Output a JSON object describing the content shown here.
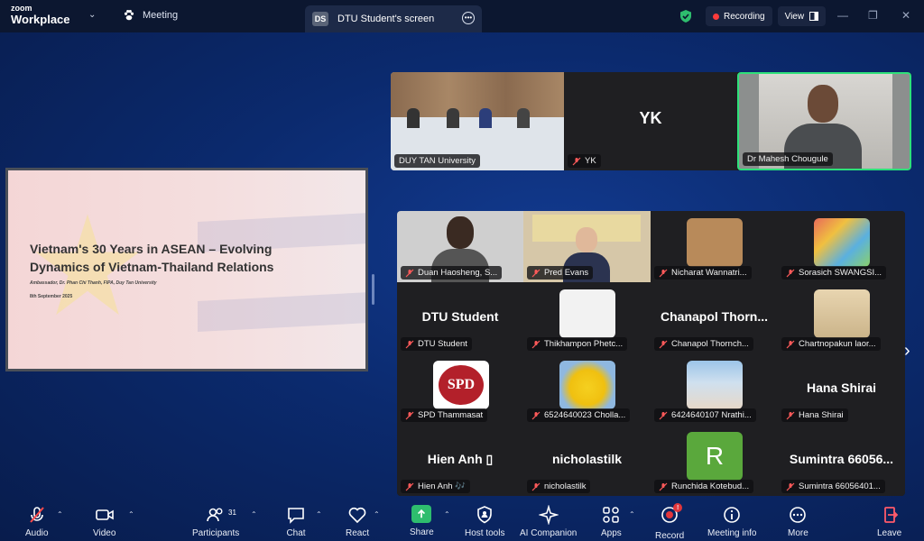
{
  "app": {
    "logo_top": "zoom",
    "logo_bottom": "Workplace"
  },
  "tabs": {
    "meeting_label": "Meeting",
    "screen_badge": "DS",
    "screen_label": "DTU Student's screen"
  },
  "status": {
    "recording_label": "Recording",
    "view_label": "View"
  },
  "slide": {
    "title": "Vietnam's 30 Years in ASEAN – Evolving Dynamics of Vietnam-Thailand Relations",
    "subtitle": "Ambassador, Dr. Phan Chi Thanh, FIPA, Duy Tan University",
    "date": "8th September 2025"
  },
  "top_strip": [
    {
      "name": "DUY TAN University",
      "muted": false
    },
    {
      "name": "YK",
      "initials": "YK",
      "muted": true
    },
    {
      "name": "Dr Mahesh Chougule",
      "muted": false,
      "active_speaker": true
    }
  ],
  "gallery": [
    {
      "name": "Duan Haosheng, S...",
      "muted": true
    },
    {
      "name": "Pred Evans",
      "muted": true
    },
    {
      "name": "Nicharat Wannatri...",
      "muted": true
    },
    {
      "name": "Sorasich SWANGSI...",
      "muted": true
    },
    {
      "name": "DTU Student",
      "display": "DTU Student",
      "muted": true
    },
    {
      "name": "Thikhampon Phetc...",
      "muted": true
    },
    {
      "name": "Chanapol Thornch...",
      "display": "Chanapol  Thorn...",
      "muted": true
    },
    {
      "name": "Chartnopakun laor...",
      "muted": true
    },
    {
      "name": "SPD Thammasat",
      "muted": true,
      "logo_text": "SPD"
    },
    {
      "name": "6524640023 Cholla...",
      "muted": true
    },
    {
      "name": "6424640107 Nrathi...",
      "muted": true
    },
    {
      "name": "Hana Shirai",
      "display": "Hana Shirai",
      "muted": true
    },
    {
      "name": "Hien Anh 🎶",
      "display": "Hien Anh ▯",
      "muted": true
    },
    {
      "name": "nicholastilk",
      "display": "nicholastilk",
      "muted": true
    },
    {
      "name": "Runchida Kotebud...",
      "avatar_letter": "R",
      "muted": true
    },
    {
      "name": "Sumintra 66056401...",
      "display": "Sumintra  66056...",
      "muted": true
    }
  ],
  "toolbar": {
    "audio": "Audio",
    "video": "Video",
    "participants": "Participants",
    "participants_count": "31",
    "chat": "Chat",
    "react": "React",
    "share": "Share",
    "host_tools": "Host tools",
    "ai_companion": "AI Companion",
    "apps": "Apps",
    "record": "Record",
    "meeting_info": "Meeting info",
    "more": "More",
    "leave": "Leave"
  },
  "colors": {
    "accent_green": "#2ebd6e",
    "record_red": "#e2363b",
    "active_border": "#2ee07a"
  }
}
